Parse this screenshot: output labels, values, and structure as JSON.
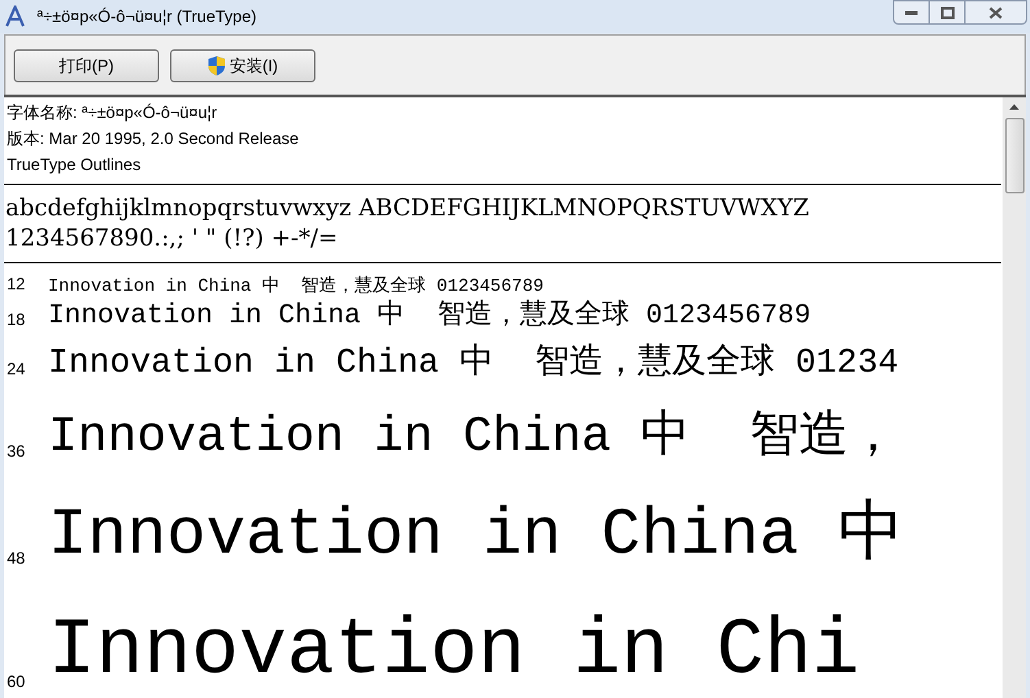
{
  "window": {
    "title": "ª÷±ö¤p«Ó-ô¬ü¤u¦r (TrueType)"
  },
  "toolbar": {
    "buttons": [
      {
        "label": "打印(P)",
        "kind": "plain"
      },
      {
        "label": "安装(I)",
        "kind": "shield"
      }
    ]
  },
  "info": [
    "字体名称: ª÷±ö¤p«Ó-ô¬ü¤u¦r",
    "版本: Mar 20 1995, 2.0 Second Release",
    "TrueType Outlines"
  ],
  "charset": [
    "abcdefghijklmnopqrstuvwxyz ABCDEFGHIJKLMNOPQRSTUVWXYZ",
    "1234567890.:,; ' \" (!?) +-*/="
  ],
  "samples": [
    {
      "size": "12",
      "text": "Innovation in China 中  智造，慧及全球 0123456789"
    },
    {
      "size": "18",
      "text": "Innovation in China 中  智造，慧及全球 0123456789"
    },
    {
      "size": "24",
      "text": "Innovation in China 中  智造，慧及全球 01234"
    },
    {
      "size": "36",
      "text": "Innovation in China 中  智造，"
    },
    {
      "size": "48",
      "text": "Innovation in China 中"
    },
    {
      "size": "60",
      "text": "Innovation in Chi"
    }
  ]
}
